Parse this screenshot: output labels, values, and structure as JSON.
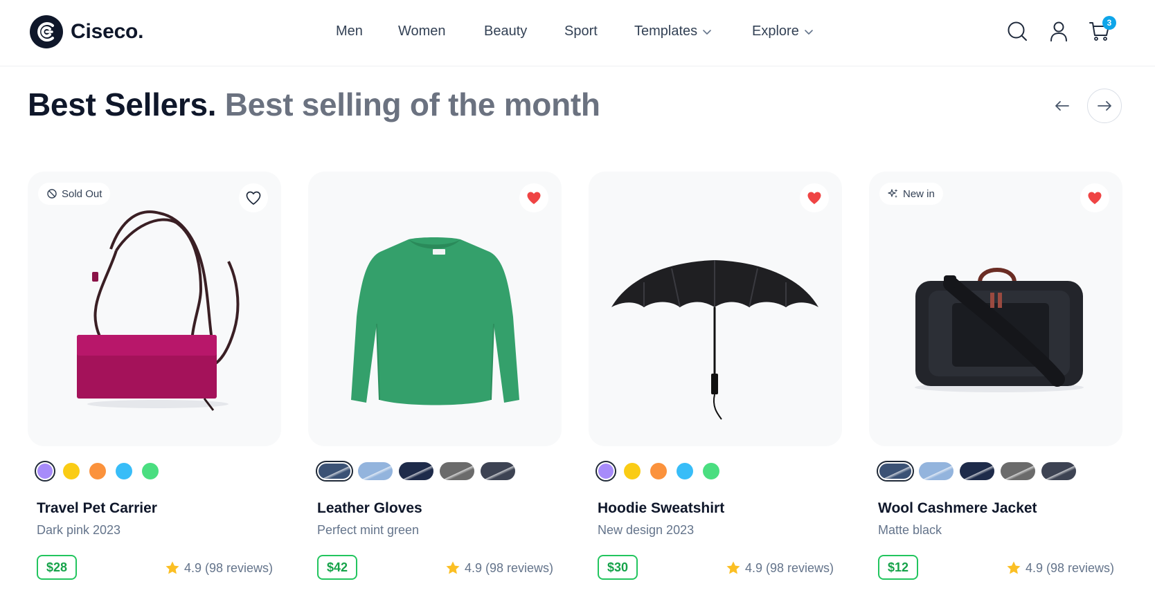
{
  "brand": {
    "name": "Ciseco."
  },
  "nav": [
    {
      "label": "Men",
      "dropdown": false
    },
    {
      "label": "Women",
      "dropdown": false
    },
    {
      "label": "Beauty",
      "dropdown": false
    },
    {
      "label": "Sport",
      "dropdown": false
    },
    {
      "label": "Templates",
      "dropdown": true
    },
    {
      "label": "Explore",
      "dropdown": true
    }
  ],
  "header_icons": [
    "search-icon",
    "user-icon",
    "cart-icon"
  ],
  "cart": {
    "count": "3"
  },
  "section": {
    "title": "Best Sellers.",
    "subtitle": "Best selling of the month"
  },
  "colors": {
    "accent": "#0ea5e9",
    "price_green": "#22c55e",
    "favorite_red": "#ef4444",
    "star": "#fbbf24"
  },
  "products": [
    {
      "name": "Travel Pet Carrier",
      "description": "Dark pink 2023",
      "price": "$28",
      "rating": "4.9 (98 reviews)",
      "badge": "Sold Out",
      "badge_icon": "no-symbol-icon",
      "favorited": false,
      "image": "pink-crossbody-bag",
      "swatch_type": "dots",
      "swatches": [
        "#a78bfa",
        "#facc15",
        "#fb923c",
        "#38bdf8",
        "#4ade80"
      ],
      "active_swatch": 0
    },
    {
      "name": "Leather Gloves",
      "description": "Perfect mint green",
      "price": "$42",
      "rating": "4.9 (98 reviews)",
      "badge": "",
      "badge_icon": "",
      "favorited": true,
      "image": "green-sweater",
      "swatch_type": "pills",
      "swatches": [
        "#3b5275",
        "#93b4dd",
        "#1e2b4a",
        "#6b6b6b",
        "#3d4353"
      ],
      "active_swatch": 0
    },
    {
      "name": "Hoodie Sweatshirt",
      "description": "New design 2023",
      "price": "$30",
      "rating": "4.9 (98 reviews)",
      "badge": "",
      "badge_icon": "",
      "favorited": true,
      "image": "black-umbrella",
      "swatch_type": "dots",
      "swatches": [
        "#a78bfa",
        "#facc15",
        "#fb923c",
        "#38bdf8",
        "#4ade80"
      ],
      "active_swatch": 0
    },
    {
      "name": "Wool Cashmere Jacket",
      "description": "Matte black",
      "price": "$12",
      "rating": "4.9 (98 reviews)",
      "badge": "New in",
      "badge_icon": "sparkles-icon",
      "favorited": true,
      "image": "black-pet-carrier-bag",
      "swatch_type": "pills",
      "swatches": [
        "#3b5275",
        "#93b4dd",
        "#1e2b4a",
        "#6b6b6b",
        "#3d4353"
      ],
      "active_swatch": 0
    }
  ]
}
